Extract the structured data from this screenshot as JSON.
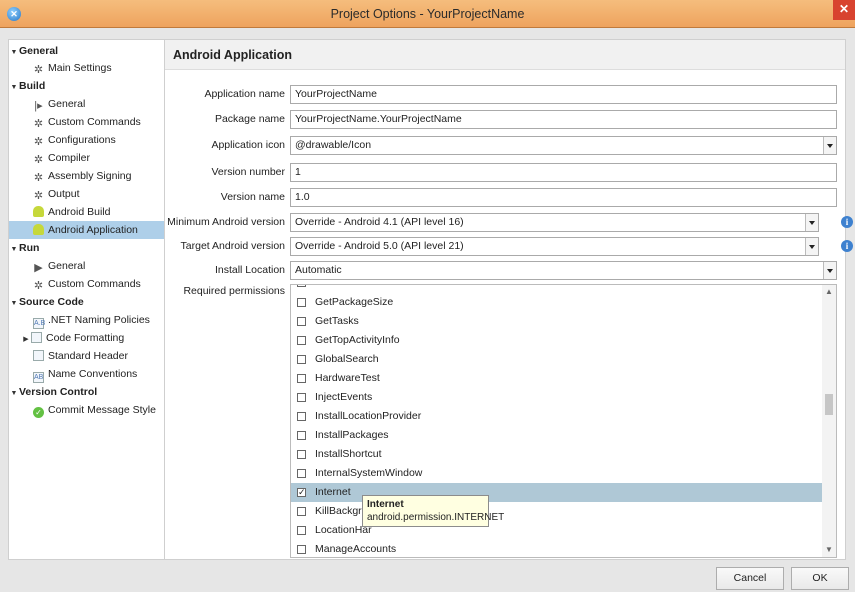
{
  "window": {
    "title": "Project Options - YourProjectName"
  },
  "sidebar": {
    "items": [
      {
        "label": "General",
        "type": "section"
      },
      {
        "label": "Main Settings",
        "icon": "gear-icon"
      },
      {
        "label": "Build",
        "type": "section"
      },
      {
        "label": "General",
        "icon": "play-icon"
      },
      {
        "label": "Custom Commands",
        "icon": "gear-icon"
      },
      {
        "label": "Configurations",
        "icon": "gear-icon"
      },
      {
        "label": "Compiler",
        "icon": "gear-icon"
      },
      {
        "label": "Assembly Signing",
        "icon": "gear-icon"
      },
      {
        "label": "Output",
        "icon": "gear-icon"
      },
      {
        "label": "Android Build",
        "icon": "android-icon"
      },
      {
        "label": "Android Application",
        "icon": "android-icon",
        "selected": true
      },
      {
        "label": "Run",
        "type": "section"
      },
      {
        "label": "General",
        "icon": "play-icon"
      },
      {
        "label": "Custom Commands",
        "icon": "gear-icon"
      },
      {
        "label": "Source Code",
        "type": "section"
      },
      {
        "label": ".NET Naming Policies",
        "icon": "document-icon",
        "icon_text": "A.B"
      },
      {
        "label": "Code Formatting",
        "icon": "document-icon"
      },
      {
        "label": "Standard Header",
        "icon": "document-icon"
      },
      {
        "label": "Name Conventions",
        "icon": "document-icon",
        "icon_text": "AB"
      },
      {
        "label": "Version Control",
        "type": "section"
      },
      {
        "label": "Commit Message Style",
        "icon": "check-circle-icon"
      }
    ]
  },
  "main": {
    "heading": "Android Application",
    "fields": {
      "app_name": {
        "label": "Application name",
        "value": "YourProjectName"
      },
      "package_name": {
        "label": "Package name",
        "value": "YourProjectName.YourProjectName"
      },
      "app_icon": {
        "label": "Application icon",
        "value": "@drawable/Icon"
      },
      "version_number": {
        "label": "Version number",
        "value": "1"
      },
      "version_name": {
        "label": "Version name",
        "value": "1.0"
      },
      "min_android": {
        "label": "Minimum Android version",
        "value": "Override - Android 4.1 (API level 16)"
      },
      "target_android": {
        "label": "Target Android version",
        "value": "Override - Android 5.0 (API level 21)"
      },
      "install_location": {
        "label": "Install Location",
        "value": "Automatic"
      }
    },
    "permissions_label": "Required permissions",
    "permissions": [
      {
        "label": "GetPackageSize",
        "checked": false
      },
      {
        "label": "GetTasks",
        "checked": false
      },
      {
        "label": "GetTopActivityInfo",
        "checked": false
      },
      {
        "label": "GlobalSearch",
        "checked": false
      },
      {
        "label": "HardwareTest",
        "checked": false
      },
      {
        "label": "InjectEvents",
        "checked": false
      },
      {
        "label": "InstallLocationProvider",
        "checked": false
      },
      {
        "label": "InstallPackages",
        "checked": false
      },
      {
        "label": "InstallShortcut",
        "checked": false
      },
      {
        "label": "InternalSystemWindow",
        "checked": false
      },
      {
        "label": "Internet",
        "checked": true,
        "selected": true
      },
      {
        "label": "KillBackgrou",
        "checked": false
      },
      {
        "label": "LocationHar",
        "checked": false
      },
      {
        "label": "ManageAccounts",
        "checked": false
      }
    ],
    "tooltip": {
      "title": "Internet",
      "text": "android.permission.INTERNET"
    }
  },
  "footer": {
    "cancel_label": "Cancel",
    "ok_label": "OK"
  },
  "colors": {
    "titlebar": "#eea35e",
    "selection": "#aecfe9",
    "close": "#d8432f",
    "info": "#3e81cf"
  }
}
